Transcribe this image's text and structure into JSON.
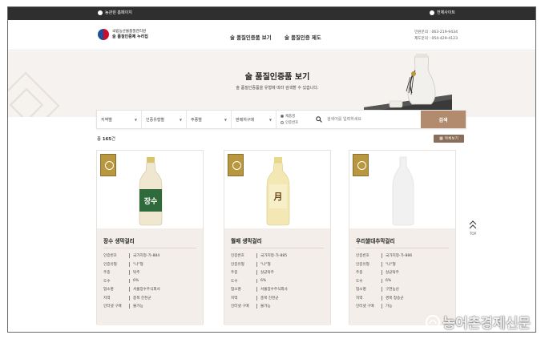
{
  "topbar": {
    "left_label": "농관원 홈페이지",
    "right_label": "전체사이트"
  },
  "header": {
    "logo_line1": "국립농산물품질관리원",
    "logo_line2": "술 품질인증제 누리집",
    "nav": [
      "술 품질인증품 보기",
      "술 품질인증 제도"
    ],
    "contact_lines": [
      "민원문의 : 063-219-9434",
      "제도문의 : 054-429-4123"
    ]
  },
  "hero": {
    "title": "술 품질인증품 보기",
    "subtitle": "술 품질인증품을 유형에 따라 검색할 수 있습니다."
  },
  "search": {
    "filters": [
      "지역별",
      "인증유형별",
      "주종별",
      "판매처구매"
    ],
    "radio_options": [
      "제품명",
      "인증번호"
    ],
    "radio_selected": 0,
    "placeholder": "검색어를 입력하세요",
    "button_label": "검색"
  },
  "results": {
    "count_prefix": "총",
    "count_value": "165",
    "count_suffix": "건",
    "list_button_label": "목록보기"
  },
  "side": {
    "top_label": "TOP"
  },
  "cards": [
    {
      "name": "장수 생막걸리",
      "rows": [
        {
          "k": "인증번호",
          "v": "국가지정-가-884"
        },
        {
          "k": "인증유형",
          "v": "\"나\"형"
        },
        {
          "k": "주종",
          "v": "탁주"
        },
        {
          "k": "도수",
          "v": "6%"
        },
        {
          "k": "업소명",
          "v": "서울장수주식회사"
        },
        {
          "k": "지역",
          "v": "충북 진천군"
        },
        {
          "k": "인터넷 구매",
          "v": "불가능"
        }
      ]
    },
    {
      "name": "월매 생막걸리",
      "rows": [
        {
          "k": "인증번호",
          "v": "국가지정-가-885"
        },
        {
          "k": "인증유형",
          "v": "\"나\"형"
        },
        {
          "k": "주종",
          "v": "살균탁주"
        },
        {
          "k": "도수",
          "v": "6%"
        },
        {
          "k": "업소명",
          "v": "서울장수주식회사"
        },
        {
          "k": "지역",
          "v": "충북 진천군"
        },
        {
          "k": "인터넷 구매",
          "v": "불가능"
        }
      ]
    },
    {
      "name": "우리쌀대추막걸리",
      "rows": [
        {
          "k": "인증번호",
          "v": "국가지정-가-886"
        },
        {
          "k": "인증유형",
          "v": "\"나\"형"
        },
        {
          "k": "주종",
          "v": "살균탁주"
        },
        {
          "k": "도수",
          "v": "6%"
        },
        {
          "k": "업소명",
          "v": "구연농산"
        },
        {
          "k": "지역",
          "v": "경북 청송군"
        },
        {
          "k": "인터넷 구매",
          "v": "가능"
        }
      ]
    }
  ],
  "watermark": "농어촌경제신문"
}
